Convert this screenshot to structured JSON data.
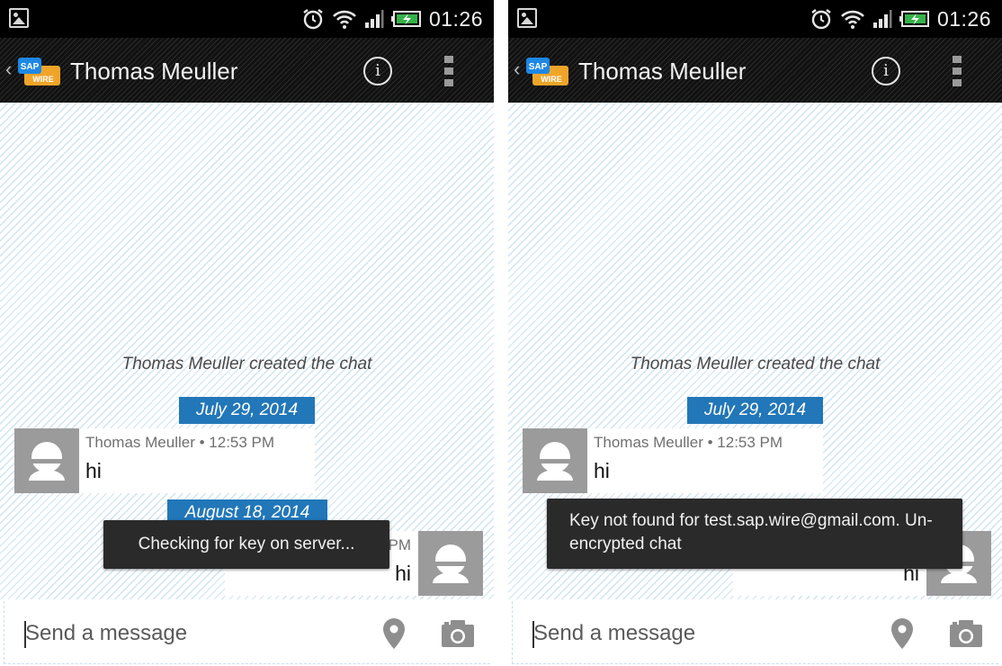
{
  "status_bar": {
    "time": "01:26"
  },
  "screens": [
    {
      "chat_title": "Thomas Meuller",
      "system_message": "Thomas Meuller created the chat",
      "date_1": "July 29, 2014",
      "date_2": "August 18, 2014",
      "incoming": {
        "sender": "Thomas Meuller",
        "time": "12:53 PM",
        "text": "hi"
      },
      "outgoing": {
        "meta_partial": "PM",
        "text": "hi"
      },
      "toast": "Checking for key on server...",
      "input_placeholder": "Send a message"
    },
    {
      "chat_title": "Thomas Meuller",
      "system_message": "Thomas Meuller created the chat",
      "date_1": "July 29, 2014",
      "incoming": {
        "sender": "Thomas Meuller",
        "time": "12:53 PM",
        "text": "hi"
      },
      "outgoing": {
        "text": "hi"
      },
      "toast": "Key not found for test.sap.wire@gmail.com. Un-encrypted chat",
      "input_placeholder": "Send a message"
    }
  ],
  "app_logo": {
    "line1": "SAP",
    "line2": "WIRE"
  },
  "icons": {
    "status": [
      "gallery-notification-icon",
      "alarm-icon",
      "wifi-icon",
      "signal-icon",
      "battery-charging-icon"
    ],
    "action_bar": [
      "back-chevron-icon",
      "app-logo-icon",
      "info-icon",
      "overflow-menu-icon"
    ],
    "input_bar": [
      "location-pin-icon",
      "camera-icon"
    ],
    "avatar": "default-user-avatar-icon"
  },
  "colors": {
    "accent": "#2277b8",
    "toast_bg": "#2a2a2a",
    "status_bar": "#000000",
    "chat_stripe": "#cfe4f1"
  }
}
